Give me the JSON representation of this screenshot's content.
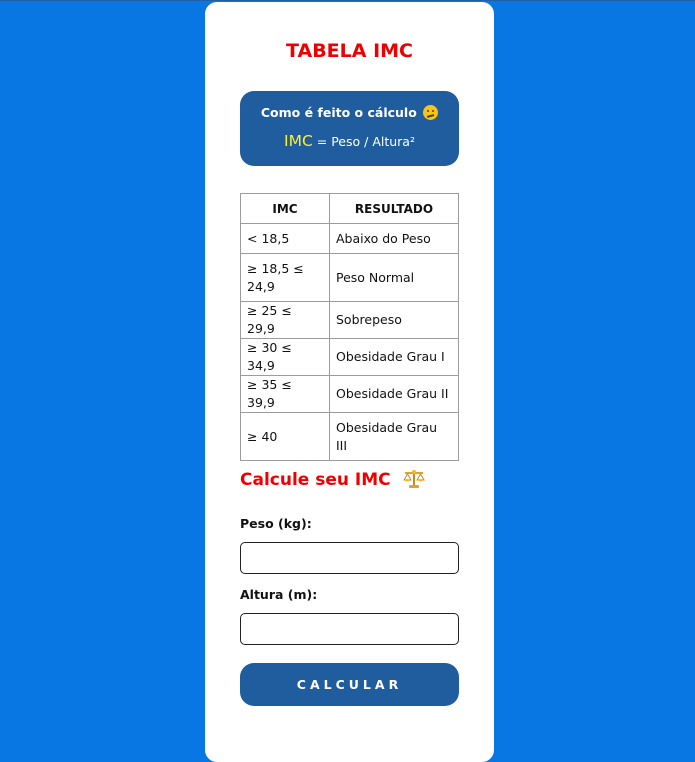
{
  "page": {
    "title": "TABELA IMC"
  },
  "info_box": {
    "title": "Como é feito o cálculo",
    "title_emoji": "thinking-face-icon",
    "formula_highlight": "IMC",
    "formula_rest": " = Peso / Altura²"
  },
  "table": {
    "headers": [
      "IMC",
      "RESULTADO"
    ],
    "rows": [
      {
        "imc": "< 18,5",
        "resultado": "Abaixo do Peso"
      },
      {
        "imc": "≥ 18,5 ≤ 24,9",
        "resultado": "Peso Normal"
      },
      {
        "imc": "≥ 25 ≤ 29,9",
        "resultado": "Sobrepeso"
      },
      {
        "imc": "≥ 30 ≤ 34,9",
        "resultado": "Obesidade Grau I"
      },
      {
        "imc": "≥ 35 ≤ 39,9",
        "resultado": "Obesidade Grau II"
      },
      {
        "imc": "≥ 40",
        "resultado": "Obesidade Grau III"
      }
    ]
  },
  "calculator": {
    "heading": "Calcule seu IMC",
    "heading_icon": "scales-icon",
    "peso_label": "Peso (kg):",
    "peso_value": "",
    "altura_label": "Altura (m):",
    "altura_value": "",
    "button_label": "CALCULAR"
  },
  "colors": {
    "background": "#0877e3",
    "accent_blue": "#1f5d9e",
    "title_red": "#ee0000",
    "formula_yellow": "#ffee33"
  }
}
